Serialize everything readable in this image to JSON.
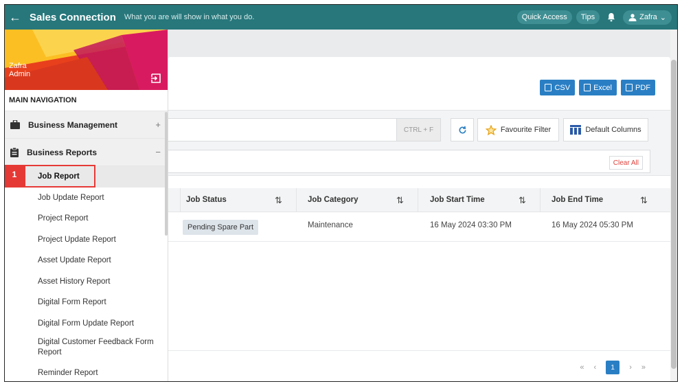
{
  "app": {
    "title": "Sales Connection",
    "tagline": "What you are will show in what you do."
  },
  "topbar": {
    "quick_access": "Quick Access",
    "tips": "Tips",
    "user_name": "Zafra"
  },
  "sidebar": {
    "profile": {
      "name": "Zafra",
      "role": "Admin"
    },
    "nav_title": "MAIN NAVIGATION",
    "groups": [
      {
        "label": "Business Management",
        "toggle": "+"
      },
      {
        "label": "Business Reports",
        "toggle": "−"
      }
    ],
    "items": [
      "Job Report",
      "Job Update Report",
      "Project Report",
      "Project Update Report",
      "Asset Update Report",
      "Asset History Report",
      "Digital Form Report",
      "Digital Form Update Report",
      "Digital Customer Feedback Form Report",
      "Reminder Report"
    ],
    "step_number": "1"
  },
  "exports": {
    "csv": "CSV",
    "excel": "Excel",
    "pdf": "PDF"
  },
  "filters": {
    "search_shortcut": "CTRL + F",
    "favourite_filter": "Favourite Filter",
    "default_columns": "Default Columns",
    "clear_all": "Clear All"
  },
  "table": {
    "columns": [
      "Job Status",
      "Job Category",
      "Job Start Time",
      "Job End Time"
    ],
    "sort_glyph": "⇅",
    "rows": [
      {
        "status": "Pending Spare Part",
        "category": "Maintenance",
        "start": "16 May 2024 03:30 PM",
        "end": "16 May 2024 05:30 PM"
      }
    ]
  },
  "pagination": {
    "first": "«",
    "prev": "‹",
    "current": "1",
    "next": "›",
    "last": "»"
  },
  "colors": {
    "topbar": "#27777b",
    "primary": "#2a7fc4",
    "highlight": "#e53935"
  }
}
